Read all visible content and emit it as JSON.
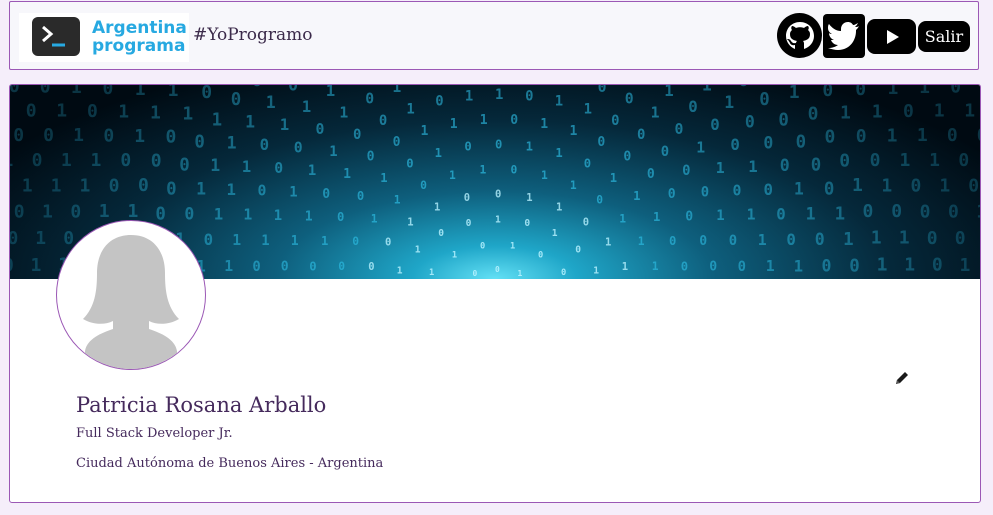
{
  "header": {
    "logo_line1": "Argentina",
    "logo_line2": "programa",
    "hashtag": "#YoProgramo",
    "social": [
      "github-icon",
      "twitter-icon",
      "youtube-icon"
    ],
    "logout_label": "Salir"
  },
  "profile": {
    "name": "Patricia Rosana Arballo",
    "title": "Full Stack Developer Jr.",
    "location": "Ciudad Autónoma de Buenos Aires - Argentina",
    "edit_icon": "pencil-icon"
  },
  "colors": {
    "accent": "#9b58b5",
    "text": "#452a5c",
    "page_bg": "#f5eefa",
    "logo_blue": "#27a9e1"
  }
}
